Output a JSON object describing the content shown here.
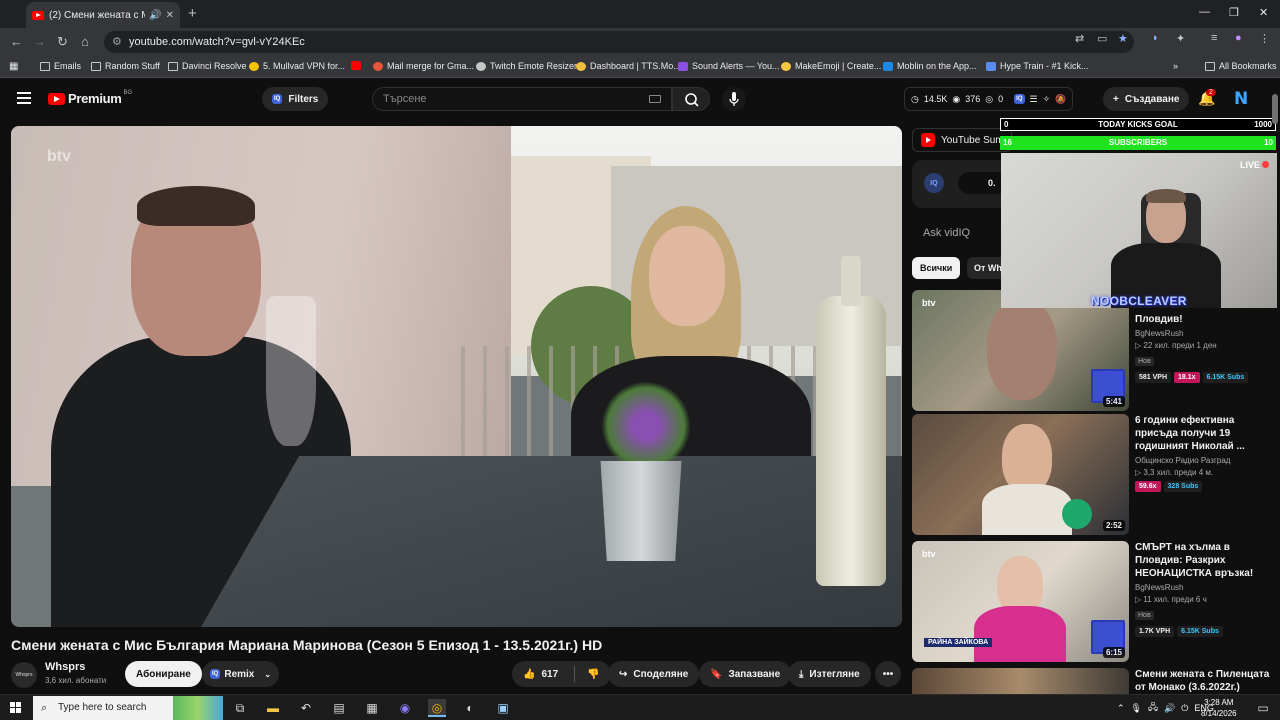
{
  "browser": {
    "tab_title": "(2) Смени жената с Мис Б",
    "url": "youtube.com/watch?v=gvl-vY24KEc",
    "bookmarks": [
      {
        "label": "Emails",
        "icon": "apps-grid-icon"
      },
      {
        "label": "Random Stuff",
        "icon": "folder-icon"
      },
      {
        "label": "Davinci Resolve",
        "icon": "folder-icon"
      },
      {
        "label": "5. Mullvad VPN for...",
        "icon": "vpn-icon"
      },
      {
        "label": "",
        "icon": "youtube-icon"
      },
      {
        "label": "Mail merge for Gma...",
        "icon": "mail-merge-icon"
      },
      {
        "label": "Twitch Emote Resizer",
        "icon": "globe-icon"
      },
      {
        "label": "Dashboard | TTS.Mo...",
        "icon": "tts-icon"
      },
      {
        "label": "Sound Alerts — You...",
        "icon": "sound-alerts-icon"
      },
      {
        "label": "MakeEmoji | Create...",
        "icon": "emoji-icon"
      },
      {
        "label": "Moblin on the App...",
        "icon": "app-store-icon"
      },
      {
        "label": "Hype Train - #1 Kick...",
        "icon": "hype-train-icon"
      }
    ],
    "all_bookmarks": "All Bookmarks"
  },
  "masthead": {
    "logo": "Premium",
    "region": "BG",
    "filters_label": "Filters",
    "search_placeholder": "Търсене",
    "stats": {
      "views": "14.5K",
      "likes": "376",
      "other": "0"
    },
    "create_label": "Създаване",
    "notifications": "2",
    "avatar_letter": "N"
  },
  "video": {
    "watermark": "btv",
    "title": "Смени жената с Мис България Мариана Маринова (Сезон 5 Епизод 1 - 13.5.2021г.) HD",
    "channel": "Whsprs",
    "channel_avatar": "Whsprs",
    "subscribers": "3,6 хил. абонати",
    "subscribe_label": "Абониране",
    "remix_label": "Remix",
    "likes": "617",
    "share_label": "Споделяне",
    "save_label": "Запазване",
    "download_label": "Изтегляне"
  },
  "sidebar": {
    "summary_label": "YouTube Sum",
    "vidiq_percent": "0.",
    "ask_placeholder": "Ask vidIQ",
    "chips": [
      "Всички",
      "От Wh"
    ],
    "videos": [
      {
        "title": "Пловдив!",
        "channel": "BgNewsRush",
        "meta": "▷ 22 хил.  преди 1 ден",
        "new": "Нов",
        "vph": "581 VPH",
        "multiplier": "18.1x",
        "subs": "6.15K Subs",
        "duration": "5:41",
        "logo": "btv"
      },
      {
        "title": "6 години ефективна присъда получи 19 годишният Николай ...",
        "channel": "Общинско Радио Разград",
        "meta": "▷ 3,3 хил.  преди 4 м.",
        "new": "",
        "vph": "",
        "multiplier": "59.6x",
        "subs": "328 Subs",
        "duration": "2:52",
        "logo": ""
      },
      {
        "title": "СМЪРТ на хълма в Пловдив: Разкрих НЕОНАЦИСТКА връзка!",
        "channel": "BgNewsRush",
        "meta": "▷ 11 хил.  преди 6 ч",
        "new": "Нов",
        "vph": "1.7K VPH",
        "multiplier": "",
        "subs": "6.15K Subs",
        "duration": "6:15",
        "logo": "btv",
        "lower_third": "РАЙНА ЗАЙКОВА"
      },
      {
        "title": "Смени жената с Пиленцата от Монако (3.6.2022г.)",
        "channel": "",
        "meta": "",
        "new": "",
        "vph": "",
        "multiplier": "",
        "subs": "",
        "duration": "",
        "logo": ""
      }
    ]
  },
  "overlay": {
    "goal_min": "0",
    "goal_title": "TODAY KICKS GOAL",
    "goal_max": "1000",
    "subs_left": "16",
    "subs_title": "SUBSCRIBERS",
    "subs_right": "10",
    "live_label": "LIVE",
    "streamer": "NOOBCLEAVER"
  },
  "taskbar": {
    "search_placeholder": "Type here to search",
    "lang": "ENG",
    "time": "3:28 AM",
    "date": "8/14/2026"
  }
}
